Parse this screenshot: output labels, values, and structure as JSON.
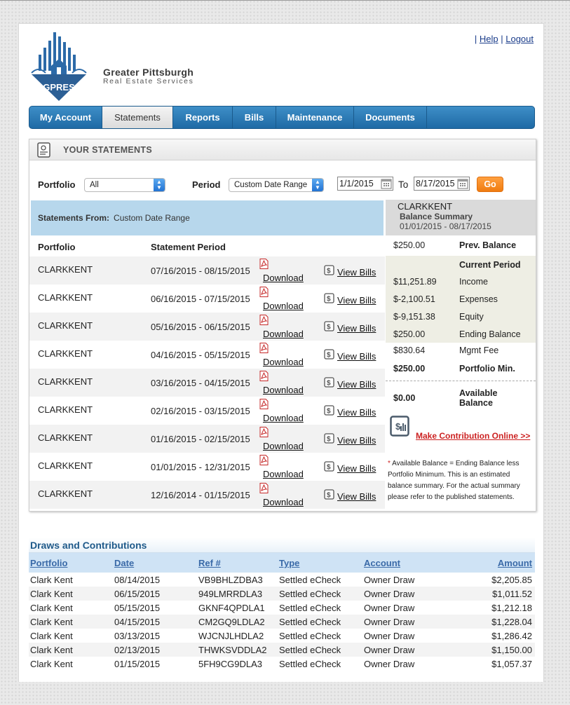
{
  "header": {
    "brand_line1": "Greater Pittsburgh",
    "brand_line2": "Real Estate Services",
    "logo_text": "GPRES",
    "links": {
      "help": "Help",
      "logout": "Logout",
      "sep": "|"
    }
  },
  "nav": {
    "tabs": [
      {
        "label": "My Account"
      },
      {
        "label": "Statements",
        "active": true
      },
      {
        "label": "Reports"
      },
      {
        "label": "Bills"
      },
      {
        "label": "Maintenance"
      },
      {
        "label": "Documents"
      }
    ]
  },
  "panel": {
    "title": "YOUR STATEMENTS"
  },
  "filters": {
    "portfolio_label": "Portfolio",
    "portfolio_value": "All",
    "period_label": "Period",
    "period_value": "Custom Date Range",
    "from_date": "1/1/2015",
    "to_label": "To",
    "to_date": "8/17/2015",
    "go_label": "Go"
  },
  "statements": {
    "from_label": "Statements From:",
    "from_value": "Custom Date Range",
    "col_portfolio": "Portfolio",
    "col_period": "Statement Period",
    "download_label": "Download",
    "viewbills_label": "View Bills",
    "rows": [
      {
        "portfolio": "CLARKKENT",
        "period": "07/16/2015 - 08/15/2015"
      },
      {
        "portfolio": "CLARKKENT",
        "period": "06/16/2015 - 07/15/2015"
      },
      {
        "portfolio": "CLARKKENT",
        "period": "05/16/2015 - 06/15/2015"
      },
      {
        "portfolio": "CLARKKENT",
        "period": "04/16/2015 - 05/15/2015"
      },
      {
        "portfolio": "CLARKKENT",
        "period": "03/16/2015 - 04/15/2015"
      },
      {
        "portfolio": "CLARKKENT",
        "period": "02/16/2015 - 03/15/2015"
      },
      {
        "portfolio": "CLARKKENT",
        "period": "01/16/2015 - 02/15/2015"
      },
      {
        "portfolio": "CLARKKENT",
        "period": "01/01/2015 - 12/31/2015"
      },
      {
        "portfolio": "CLARKKENT",
        "period": "12/16/2014 - 01/15/2015"
      }
    ]
  },
  "summary": {
    "name": "CLARKKENT",
    "title": "Balance Summary",
    "range": "01/01/2015 - 08/17/2015",
    "prev_value": "$250.00",
    "prev_label": "Prev. Balance",
    "current_label": "Current Period",
    "income_value": "$11,251.89",
    "income_label": "Income",
    "expenses_value": "$-2,100.51",
    "expenses_label": "Expenses",
    "equity_value": "$-9,151.38",
    "equity_label": "Equity",
    "ending_value": "$250.00",
    "ending_label": "Ending Balance",
    "mgmt_value": "$830.64",
    "mgmt_label": "Mgmt Fee",
    "min_value": "$250.00",
    "min_label": "Portfolio Min.",
    "avail_value": "$0.00",
    "avail_label1": "Available",
    "avail_label2": "Balance",
    "contrib_link": "Make Contribution Online >>",
    "note_star": "*",
    "note_text": "Available Balance = Ending Balance less Portfolio Minimum. This is an estimated balance summary. For the actual summary please refer to the published statements."
  },
  "draws": {
    "title": "Draws and Contributions",
    "headers": {
      "portfolio": "Portfolio",
      "date": "Date",
      "ref": "Ref #",
      "type": "Type",
      "account": "Account",
      "amount": "Amount"
    },
    "rows": [
      {
        "portfolio": "Clark Kent",
        "date": "08/14/2015",
        "ref": "VB9BHLZDBA3",
        "type": "Settled eCheck",
        "account": "Owner Draw",
        "amount": "$2,205.85"
      },
      {
        "portfolio": "Clark Kent",
        "date": "06/15/2015",
        "ref": "949LMRRDLA3",
        "type": "Settled eCheck",
        "account": "Owner Draw",
        "amount": "$1,011.52"
      },
      {
        "portfolio": "Clark Kent",
        "date": "05/15/2015",
        "ref": "GKNF4QPDLA1",
        "type": "Settled eCheck",
        "account": "Owner Draw",
        "amount": "$1,212.18"
      },
      {
        "portfolio": "Clark Kent",
        "date": "04/15/2015",
        "ref": "CM2GQ9LDLA2",
        "type": "Settled eCheck",
        "account": "Owner Draw",
        "amount": "$1,228.04"
      },
      {
        "portfolio": "Clark Kent",
        "date": "03/13/2015",
        "ref": "WJCNJLHDLA2",
        "type": "Settled eCheck",
        "account": "Owner Draw",
        "amount": "$1,286.42"
      },
      {
        "portfolio": "Clark Kent",
        "date": "02/13/2015",
        "ref": "THWKSVDDLA2",
        "type": "Settled eCheck",
        "account": "Owner Draw",
        "amount": "$1,150.00"
      },
      {
        "portfolio": "Clark Kent",
        "date": "01/15/2015",
        "ref": "5FH9CG9DLA3",
        "type": "Settled eCheck",
        "account": "Owner Draw",
        "amount": "$1,057.37"
      }
    ]
  },
  "colors": {
    "nav_blue": "#2a78b5",
    "accent_orange": "#f58a1f",
    "link_red": "#cc2222",
    "bar_blue": "#b7d7ec"
  }
}
